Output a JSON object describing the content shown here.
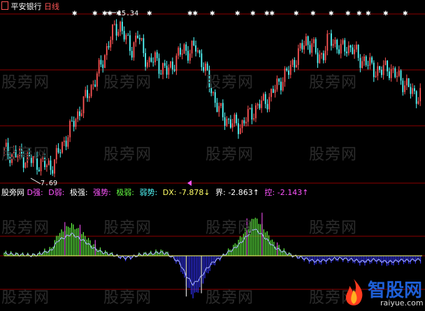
{
  "top_panel": {
    "stock_name": "平安银行",
    "period": "日线",
    "high_label": "15.34",
    "low_label": "7.69"
  },
  "bottom_panel": {
    "indicator_name": "股旁网",
    "legend": {
      "d_strong": "D强:",
      "d_weak": "D弱:",
      "extreme_strong": "极强:",
      "strong": "强势:",
      "extreme_weak": "极弱:",
      "weak": "弱势:",
      "dx": "DX: -7.878↓",
      "boundary": "界: -2.863↑",
      "control": "控: -2.143↑"
    }
  },
  "watermark": "股旁网",
  "logo": {
    "name": "智股网",
    "url": "raiyue.com"
  },
  "colors": {
    "up": "#ff5555",
    "down": "#54ffff",
    "green": "#66ff44",
    "blue": "#3333ff",
    "magenta": "#ff55ff",
    "white": "#ffffff",
    "grid": "#8b0000"
  },
  "chart_data": [
    {
      "type": "candlestick",
      "symbol": "平安银行",
      "period": "日线",
      "annotations": [
        {
          "text": "15.34",
          "value": 15.34,
          "kind": "high"
        },
        {
          "text": "7.69",
          "value": 7.69,
          "kind": "low"
        }
      ],
      "close_series": [
        8.5,
        8.4,
        8.3,
        8.2,
        8.1,
        8.0,
        7.9,
        7.8,
        7.7,
        8.2,
        8.8,
        9.4,
        10.0,
        10.6,
        11.2,
        11.8,
        12.4,
        13.2,
        14.1,
        14.8,
        15.0,
        14.2,
        13.8,
        14.5,
        13.6,
        13.0,
        13.3,
        12.8,
        12.6,
        13.0,
        13.4,
        13.8,
        13.6,
        13.9,
        13.2,
        12.3,
        11.4,
        10.6,
        10.2,
        10.0,
        9.8,
        9.9,
        10.3,
        10.6,
        10.9,
        11.1,
        11.4,
        11.9,
        12.3,
        12.6,
        13.2,
        13.7,
        14.2,
        14.0,
        13.3,
        13.6,
        14.3,
        14.1,
        13.7,
        13.9,
        13.8,
        13.3,
        13.2,
        12.9,
        12.7,
        12.6,
        12.9,
        12.5,
        12.3,
        12.0,
        11.6,
        11.4
      ]
    },
    {
      "type": "bar",
      "indicator": "DX",
      "series": [
        {
          "name": "D强",
          "color": "#ff55ff"
        },
        {
          "name": "D弱",
          "color": "#ff55ff"
        },
        {
          "name": "极强",
          "color": "#ffffff"
        },
        {
          "name": "强势",
          "color": "#ff55ff"
        },
        {
          "name": "极弱",
          "color": "#66ff44"
        },
        {
          "name": "弱势",
          "color": "#54ffff"
        }
      ],
      "values": [
        0.5,
        0.4,
        0.3,
        0.2,
        0.1,
        0.3,
        0.8,
        1.2,
        3.5,
        4.2,
        5.0,
        4.1,
        3.2,
        2.0,
        1.1,
        0.6,
        0.3,
        -0.2,
        -0.5,
        -0.3,
        0.2,
        0.4,
        0.5,
        0.8,
        0.6,
        -0.4,
        -1.5,
        -4.5,
        -6.5,
        -5.2,
        -3.0,
        -1.4,
        -0.5,
        0.6,
        1.5,
        2.8,
        4.5,
        6.2,
        5.1,
        3.6,
        2.0,
        1.2,
        0.5,
        -0.1,
        -0.4,
        -0.8,
        -1.2,
        -1.1,
        -0.9,
        -0.7,
        -0.6,
        -0.8,
        -1.0,
        -1.3,
        -1.1,
        -0.9,
        -1.2,
        -1.4,
        -1.2,
        -1.0,
        -1.1,
        -0.9
      ],
      "latest": {
        "DX": -7.878,
        "界": -2.863,
        "控": -2.143
      }
    }
  ]
}
